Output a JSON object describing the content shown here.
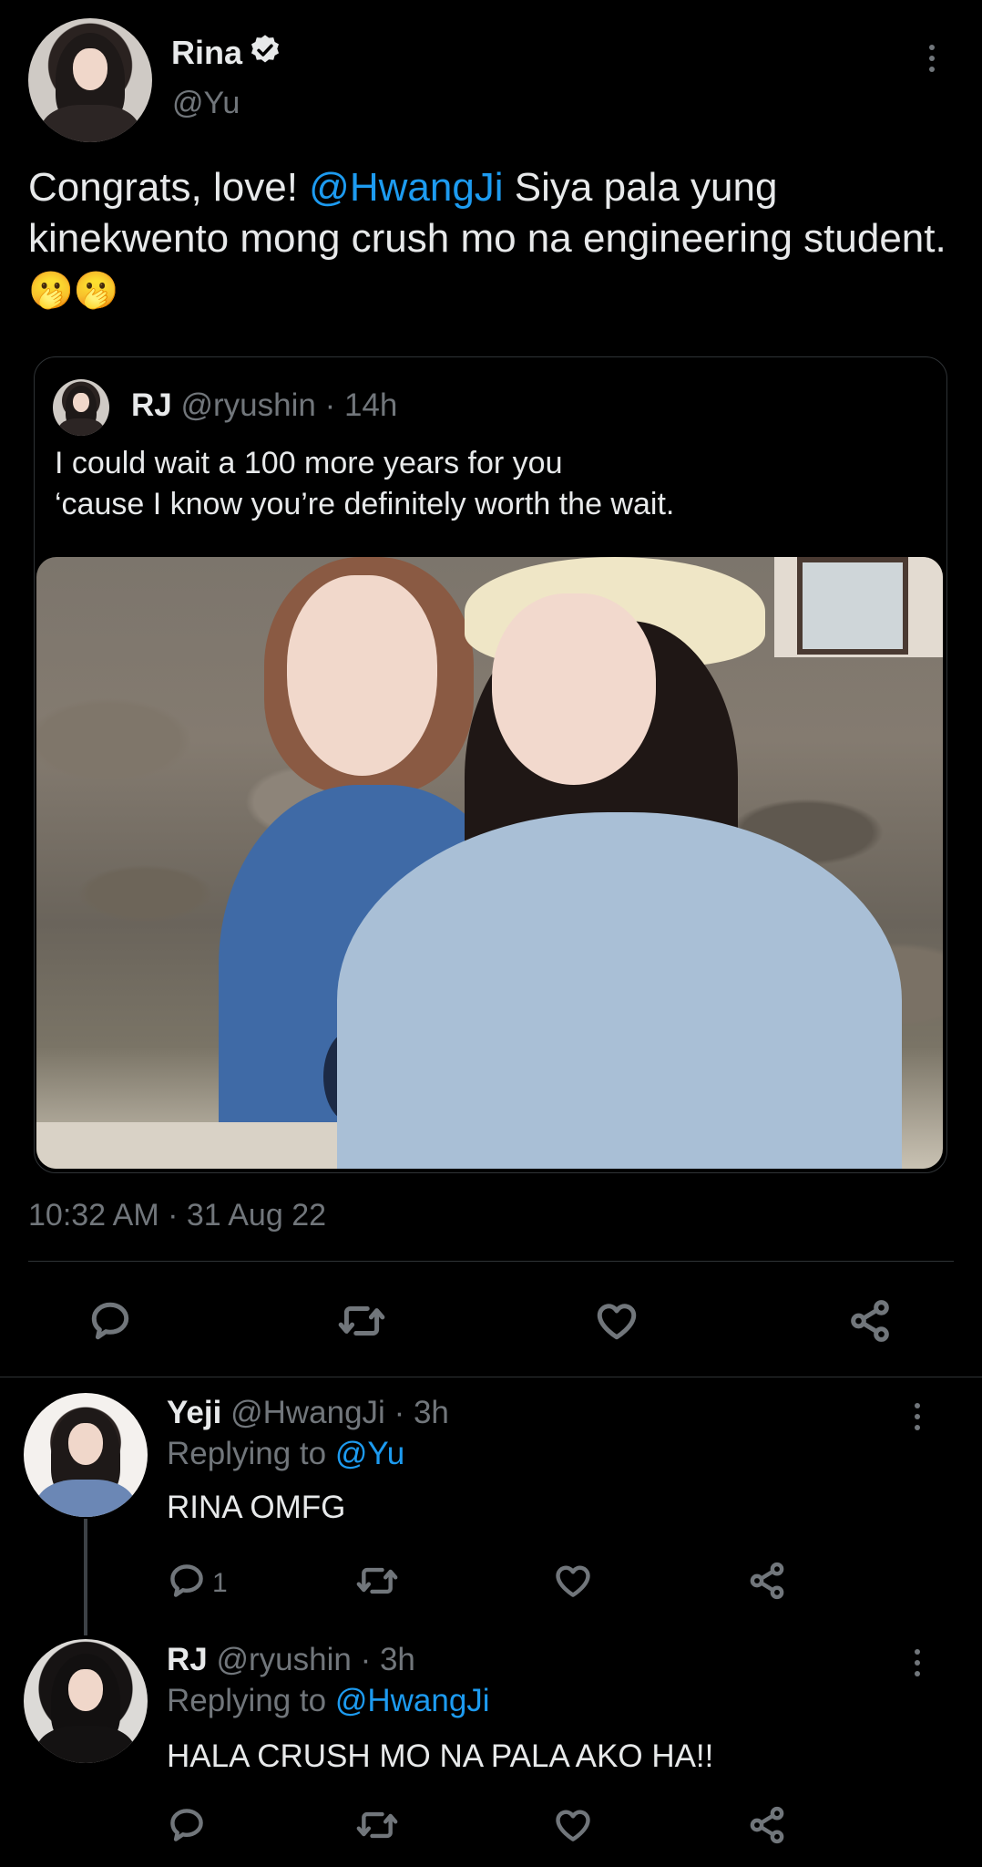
{
  "main_tweet": {
    "author_name": "Rina",
    "author_handle": "@Yu",
    "text_parts": {
      "intro": "Congrats, love! ",
      "mention": "@HwangJi",
      "rest": " Siya pala yung kinekwento mong crush mo na engineering student. ",
      "emoji": "🫢🫢"
    },
    "timestamp": "10:32 AM · 31 Aug 22",
    "quote": {
      "author_name": "RJ",
      "author_handle": "@ryushin",
      "time": "· 14h",
      "line1": "I could wait a 100 more years for you",
      "line2": "‘cause I know you’re definitely worth the wait."
    }
  },
  "replies": [
    {
      "author_name": "Yeji",
      "author_handle": "@HwangJi",
      "time": "· 3h",
      "replying_prefix": "Replying to ",
      "replying_to": "@Yu",
      "text": "RINA OMFG",
      "reply_count": "1"
    },
    {
      "author_name": "RJ",
      "author_handle": "@ryushin",
      "time": "· 3h",
      "replying_prefix": "Replying to ",
      "replying_to": "@HwangJi",
      "text": "HALA CRUSH MO NA PALA AKO HA!!",
      "reply_count": ""
    }
  ],
  "icons": {
    "verified": "verified-badge-icon",
    "reply": "reply-icon",
    "retweet": "retweet-icon",
    "like": "heart-icon",
    "share": "share-icon",
    "more": "more-vertical-icon"
  },
  "colors": {
    "background": "#000000",
    "text": "#e7e9ea",
    "muted": "#71767b",
    "link": "#1d9bf0",
    "divider": "#2f3336"
  }
}
